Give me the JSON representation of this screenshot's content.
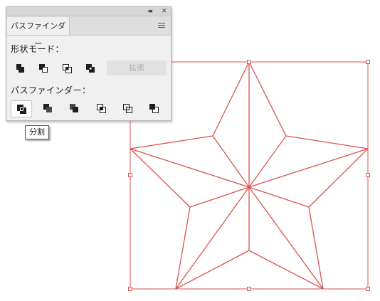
{
  "panel": {
    "tab_label": "パスファインダー",
    "collapse_glyph": "◂◂",
    "close_glyph": "✕",
    "shape_modes_label": "形状モード：",
    "shape_mode_buttons": [
      {
        "name": "unite",
        "icon": "unite-icon"
      },
      {
        "name": "minus-front",
        "icon": "minus-front-icon"
      },
      {
        "name": "intersect",
        "icon": "intersect-icon"
      },
      {
        "name": "exclude",
        "icon": "exclude-icon"
      }
    ],
    "expand_label": "拡張",
    "pathfinders_label": "パスファインダー：",
    "pathfinder_buttons": [
      {
        "name": "divide",
        "icon": "divide-icon",
        "active": true
      },
      {
        "name": "trim",
        "icon": "trim-icon"
      },
      {
        "name": "merge",
        "icon": "merge-icon"
      },
      {
        "name": "crop",
        "icon": "crop-icon"
      },
      {
        "name": "outline",
        "icon": "outline-icon"
      },
      {
        "name": "minus-back",
        "icon": "minus-back-icon"
      }
    ]
  },
  "tooltip": {
    "text": "分割"
  },
  "colors": {
    "selection_red": "#d9534f",
    "panel_bg": "#f0f0f0",
    "icon_dark": "#1e1e1e"
  }
}
